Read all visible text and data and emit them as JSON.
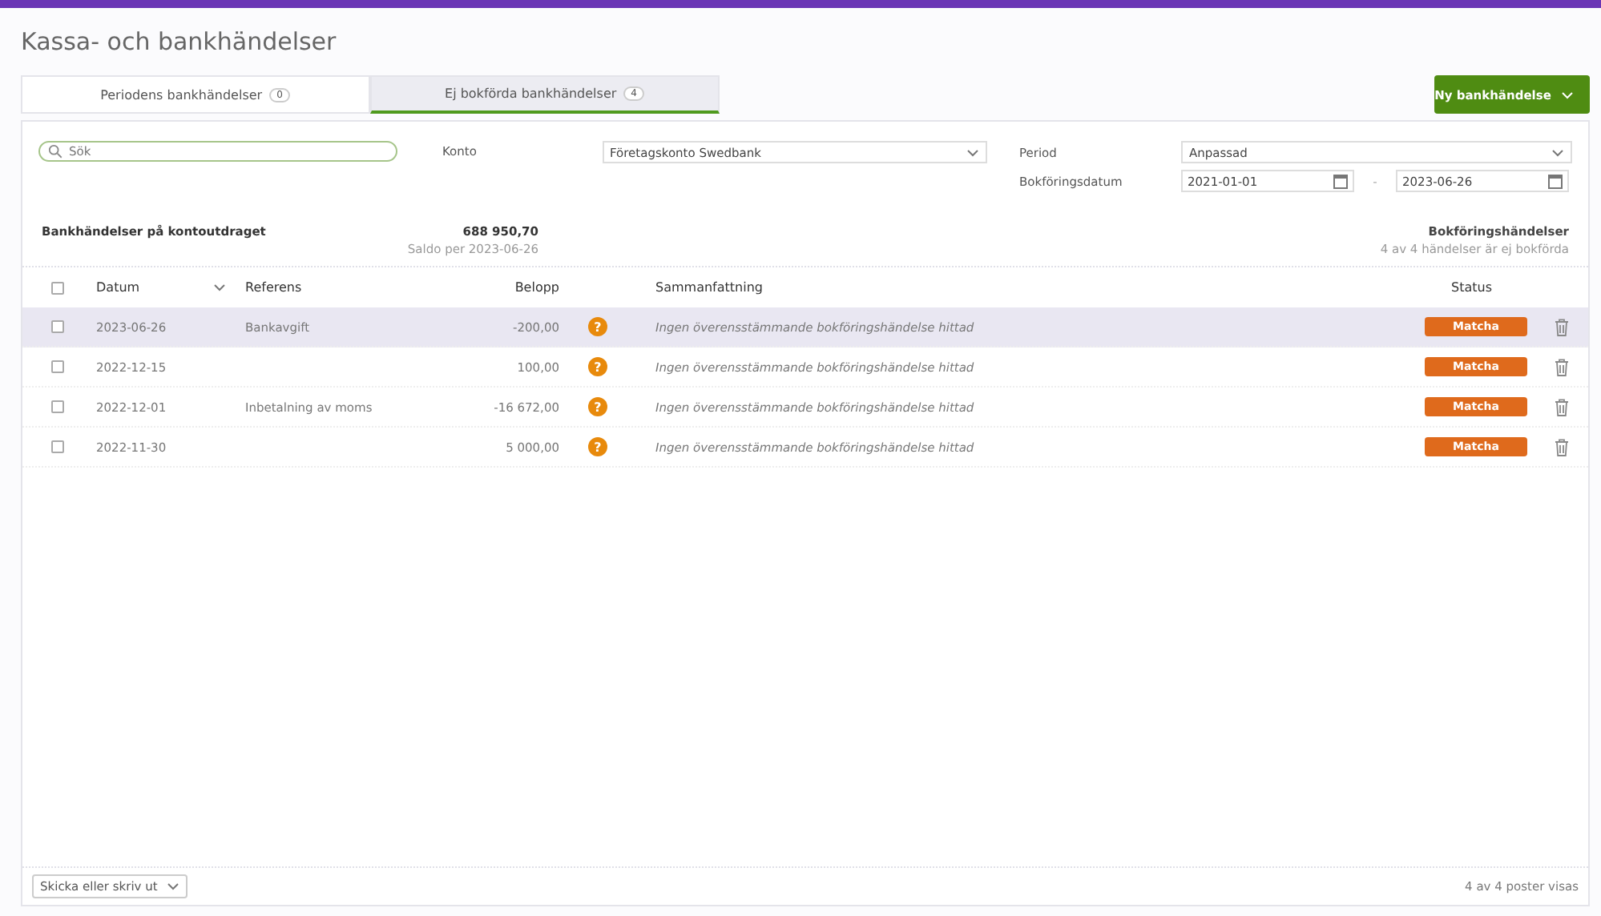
{
  "page_title": "Kassa- och bankhändelser",
  "tabs": [
    {
      "label": "Periodens bankhändelser",
      "count": "0",
      "selected": false
    },
    {
      "label": "Ej bokförda bankhändelser",
      "count": "4",
      "selected": true
    }
  ],
  "new_button": {
    "label": "Ny bankhändelse"
  },
  "filters": {
    "search": {
      "placeholder": "Sök"
    },
    "account": {
      "label": "Konto",
      "value": "Företagskonto Swedbank"
    },
    "period": {
      "label": "Period",
      "value": "Anpassad"
    },
    "date": {
      "label": "Bokföringsdatum",
      "from": "2021-01-01",
      "separator": "-",
      "to": "2023-06-26"
    }
  },
  "summary": {
    "title": "Bankhändelser på kontoutdraget",
    "amount": "688 950,70",
    "balance_note": "Saldo per 2023-06-26",
    "right_title": "Bokföringshändelser",
    "right_note": "4 av 4 händelser är ej bokförda"
  },
  "table": {
    "select_all_checked": false,
    "columns": [
      "Datum",
      "Referens",
      "Belopp",
      "Sammanfattning",
      "Status"
    ],
    "rows": [
      {
        "date": "2023-06-26",
        "reference": "Bankavgift",
        "amount": "-200,00",
        "status_icon": "?",
        "summary": "Ingen överensstämmande bokföringshändelse hittad",
        "action": "Matcha",
        "checked": false,
        "highlighted": true
      },
      {
        "date": "2022-12-15",
        "reference": "",
        "amount": "100,00",
        "status_icon": "?",
        "summary": "Ingen överensstämmande bokföringshändelse hittad",
        "action": "Matcha",
        "checked": false,
        "highlighted": false
      },
      {
        "date": "2022-12-01",
        "reference": "Inbetalning av moms",
        "amount": "-16 672,00",
        "status_icon": "?",
        "summary": "Ingen överensstämmande bokföringshändelse hittad",
        "action": "Matcha",
        "checked": false,
        "highlighted": false
      },
      {
        "date": "2022-11-30",
        "reference": "",
        "amount": "5 000,00",
        "status_icon": "?",
        "summary": "Ingen överensstämmande bokföringshändelse hittad",
        "action": "Matcha",
        "checked": false,
        "highlighted": false
      }
    ]
  },
  "footer": {
    "send_button": "Skicka eller skriv ut",
    "count": "4 av 4 poster visas"
  }
}
